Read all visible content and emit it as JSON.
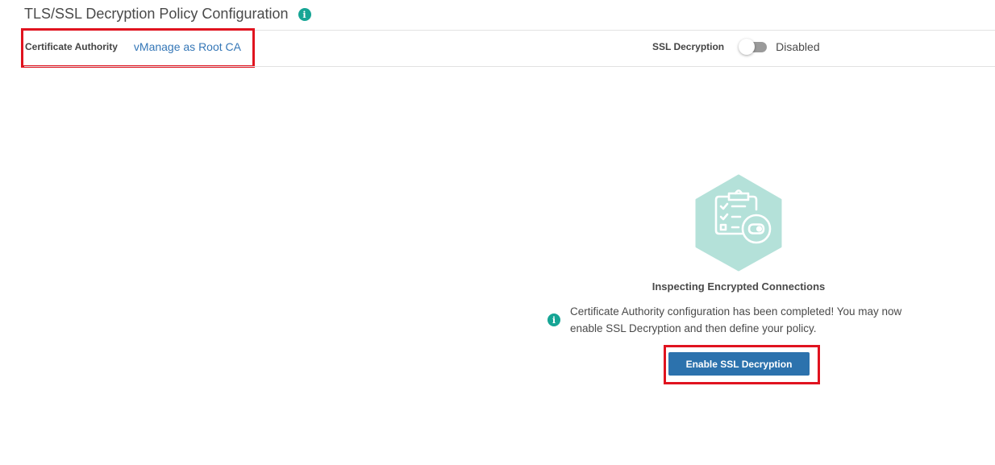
{
  "page": {
    "title": "TLS/SSL Decryption Policy Configuration",
    "info_icon_glyph": "i"
  },
  "certificate_authority": {
    "label": "Certificate Authority",
    "value": "vManage as Root CA"
  },
  "ssl_decryption": {
    "label": "SSL Decryption",
    "status": "Disabled",
    "enabled": false
  },
  "empty_state": {
    "title": "Inspecting Encrypted Connections",
    "message": "Certificate Authority configuration has been completed! You may now enable SSL Decryption and then define your policy.",
    "button_label": "Enable SSL Decryption",
    "illustration_icon": "clipboard-checklist-toggle-icon"
  },
  "colors": {
    "accent_teal": "#16a595",
    "link_blue": "#3577b7",
    "button_blue": "#2c72ad",
    "illustration_hex": "#b4e1d9",
    "highlight_red": "#e0131f"
  }
}
